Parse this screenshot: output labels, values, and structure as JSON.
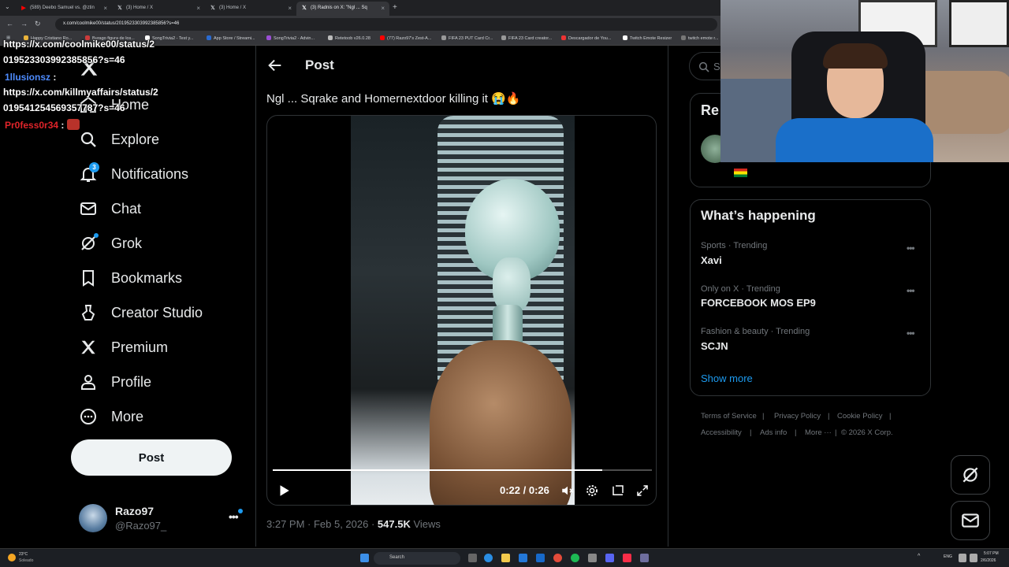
{
  "browser": {
    "tabs": [
      {
        "title": "(589) Deebo Samuel vs. @ztin",
        "icon": "youtube-icon",
        "color": "#ff0000"
      },
      {
        "title": "(3) Home / X",
        "icon": "x-icon",
        "color": "#ffffff"
      },
      {
        "title": "(3) Home / X",
        "icon": "x-icon",
        "color": "#ffffff"
      },
      {
        "title": "(3) Radnis on X: \"Ngl ... Sq",
        "icon": "x-icon",
        "color": "#ffffff"
      }
    ],
    "url": "x.com/coolmike00/status/2019523303992385856?s=46",
    "bookmarks": [
      "Happy Cristiano Ro...",
      "Burago figura de los...",
      "SongTrivia2 - Test y...",
      "App Store / Streami...",
      "SongTrivia2 - Advin...",
      "Retetoob v26.0.28",
      "(77) Razo97's Zest-A...",
      "FIFA 23 PUT Card Cr...",
      "FIFA 23 Card creator...",
      "Descargador de You...",
      "Twitch Emote Resizer",
      "twitch emote r..."
    ]
  },
  "chat": [
    {
      "user": "",
      "text": "https://x.com/coolmike00/status/2"
    },
    {
      "user": "",
      "text": "019523303992385856?s=46"
    },
    {
      "user": "1llusionsz",
      "user_color": "#4e8cff",
      "text": ""
    },
    {
      "user": "",
      "text": "https://x.com/killmyaffairs/status/2"
    },
    {
      "user": "",
      "text": "019541254569357787?s=46"
    },
    {
      "user": "Pr0fess0r34",
      "user_color": "#e0242a",
      "text": ""
    }
  ],
  "nav": {
    "items": [
      {
        "label": "Home",
        "icon": "home-icon"
      },
      {
        "label": "Explore",
        "icon": "search-icon"
      },
      {
        "label": "Notifications",
        "icon": "bell-icon",
        "badge": "3"
      },
      {
        "label": "Chat",
        "icon": "mail-icon"
      },
      {
        "label": "Grok",
        "icon": "grok-icon"
      },
      {
        "label": "Bookmarks",
        "icon": "bookmark-icon"
      },
      {
        "label": "Creator Studio",
        "icon": "creator-icon"
      },
      {
        "label": "Premium",
        "icon": "x-icon"
      },
      {
        "label": "Profile",
        "icon": "person-icon"
      },
      {
        "label": "More",
        "icon": "more-circle-icon"
      }
    ],
    "post_button": "Post",
    "profile": {
      "name": "Razo97",
      "handle": "@Razo97_"
    }
  },
  "post": {
    "header": "Post",
    "text": "Ngl ... Sqrake and Homernextdoor killing it 😭🔥",
    "video": {
      "time": "0:22 / 0:26",
      "progress": 0.87
    },
    "timestamp": "3:27 PM · Feb 5, 2026 · ",
    "views_count": "547.5K",
    "views_label": " Views"
  },
  "sidebar": {
    "search_placeholder": "S",
    "relevant_title": "Re",
    "trends_title": "What’s happening",
    "trends": [
      {
        "meta": "Sports · Trending",
        "name": "Xavi"
      },
      {
        "meta": "Only on X · Trending",
        "name": "FORCEBOOK MOS EP9"
      },
      {
        "meta": "Fashion & beauty · Trending",
        "name": "SCJN"
      }
    ],
    "show_more": "Show more",
    "footer_line1": [
      "Terms of Service",
      "Privacy Policy",
      "Cookie Policy"
    ],
    "footer_line2": [
      "Accessibility",
      "Ads info",
      "More ···",
      "© 2026 X Corp."
    ]
  },
  "taskbar": {
    "weather_temp": "23°C",
    "weather_desc": "Soleado",
    "search": "Search",
    "lang": "ENG",
    "time": "5:07 PM",
    "date": "2/6/2026"
  }
}
